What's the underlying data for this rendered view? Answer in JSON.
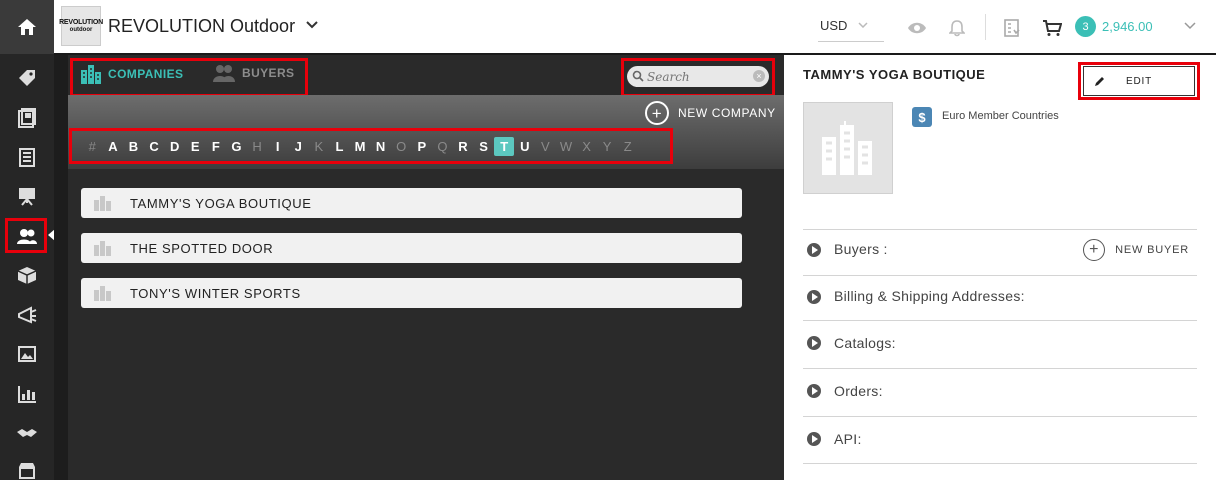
{
  "store": {
    "logo_line1": "REVOLUTION",
    "logo_line2": "outdoor",
    "title": "REVOLUTION Outdoor"
  },
  "header": {
    "currency": "USD",
    "cart_count": "3",
    "cart_amount": "2,946.00"
  },
  "tabs": [
    {
      "label": "COMPANIES",
      "active": true
    },
    {
      "label": "BUYERS",
      "active": false
    }
  ],
  "search": {
    "placeholder": "Search",
    "value": ""
  },
  "new_company_label": "NEW COMPANY",
  "alphabet": [
    {
      "l": "#",
      "state": "off"
    },
    {
      "l": "A",
      "state": "on"
    },
    {
      "l": "B",
      "state": "on"
    },
    {
      "l": "C",
      "state": "on"
    },
    {
      "l": "D",
      "state": "on"
    },
    {
      "l": "E",
      "state": "on"
    },
    {
      "l": "F",
      "state": "on"
    },
    {
      "l": "G",
      "state": "on"
    },
    {
      "l": "H",
      "state": "off"
    },
    {
      "l": "I",
      "state": "on"
    },
    {
      "l": "J",
      "state": "on"
    },
    {
      "l": "K",
      "state": "off"
    },
    {
      "l": "L",
      "state": "on"
    },
    {
      "l": "M",
      "state": "on"
    },
    {
      "l": "N",
      "state": "on"
    },
    {
      "l": "O",
      "state": "off"
    },
    {
      "l": "P",
      "state": "on"
    },
    {
      "l": "Q",
      "state": "off"
    },
    {
      "l": "R",
      "state": "on"
    },
    {
      "l": "S",
      "state": "on"
    },
    {
      "l": "T",
      "state": "sel"
    },
    {
      "l": "U",
      "state": "on"
    },
    {
      "l": "V",
      "state": "off"
    },
    {
      "l": "W",
      "state": "off"
    },
    {
      "l": "X",
      "state": "off"
    },
    {
      "l": "Y",
      "state": "off"
    },
    {
      "l": "Z",
      "state": "off"
    }
  ],
  "companies": [
    "TAMMY'S YOGA BOUTIQUE",
    "THE SPOTTED DOOR",
    "TONY'S WINTER SPORTS"
  ],
  "detail": {
    "title": "TAMMY'S YOGA BOUTIQUE",
    "edit_label": "EDIT",
    "currency_symbol": "$",
    "currency_label": "Euro Member Countries",
    "sections": [
      "Buyers :",
      "Billing & Shipping Addresses:",
      "Catalogs:",
      "Orders:",
      "API:"
    ],
    "new_buyer_label": "NEW BUYER"
  },
  "colors": {
    "accent": "#3bbfb6",
    "highlight": "#e8000b",
    "dark_panel": "#2a2a2a",
    "rail": "#262626"
  },
  "rail_icons": [
    "home-icon",
    "tag-icon",
    "catalog-icon",
    "orders-icon",
    "presentation-icon",
    "customers-icon",
    "box-icon",
    "promotions-icon",
    "images-icon",
    "reports-icon",
    "handshake-icon",
    "storefront-icon"
  ]
}
